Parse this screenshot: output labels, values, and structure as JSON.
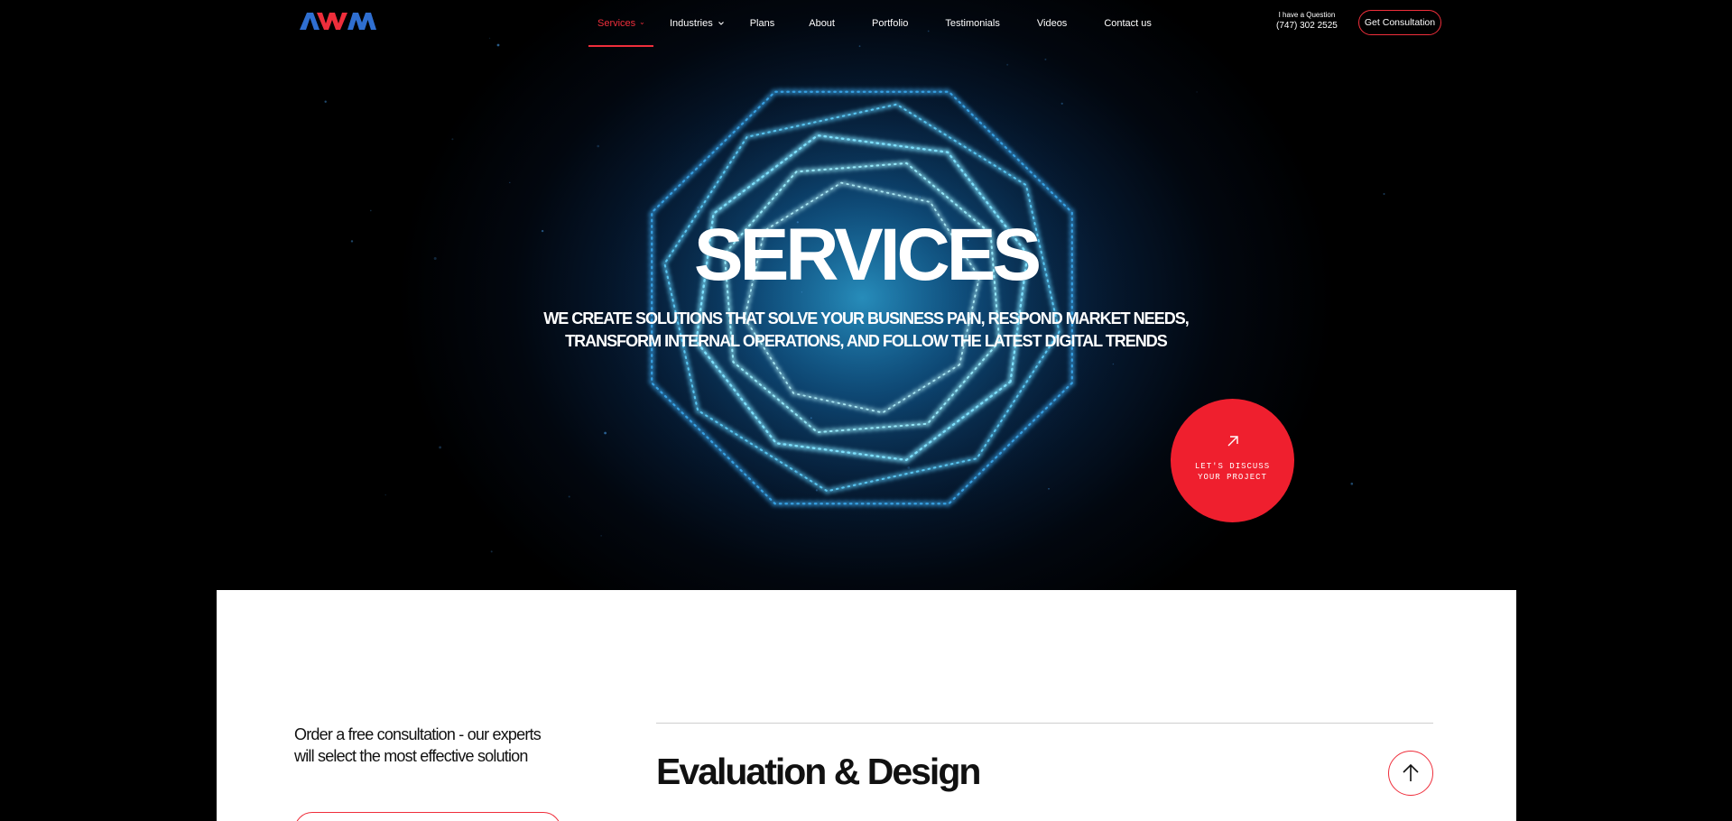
{
  "brand": {
    "logo_text": "AWM",
    "accent_color": "#ef2e3b",
    "logo_blue": "#2f6fd1"
  },
  "nav": {
    "items": [
      {
        "label": "Services",
        "active": true,
        "has_dropdown": true
      },
      {
        "label": "Industries",
        "active": false,
        "has_dropdown": true
      },
      {
        "label": "Plans",
        "active": false,
        "has_dropdown": false
      },
      {
        "label": "About",
        "active": false,
        "has_dropdown": false
      },
      {
        "label": "Portfolio",
        "active": false,
        "has_dropdown": false
      },
      {
        "label": "Testimonials",
        "active": false,
        "has_dropdown": false
      },
      {
        "label": "Videos",
        "active": false,
        "has_dropdown": false
      },
      {
        "label": "Contact us",
        "active": false,
        "has_dropdown": false
      }
    ]
  },
  "header": {
    "question_label": "I have a Question",
    "phone": "(747) 302 2525",
    "cta_label": "Get Consultation"
  },
  "hero": {
    "title": "SERVICES",
    "subtitle_line1": "WE CREATE SOLUTIONS THAT SOLVE YOUR BUSINESS PAIN, RESPOND MARKET NEEDS,",
    "subtitle_line2": "TRANSFORM INTERNAL OPERATIONS, AND FOLLOW THE LATEST DIGITAL TRENDS",
    "discuss_line1": "LET'S DISCUSS",
    "discuss_line2": "YOUR PROJECT",
    "icons": {
      "discuss": "arrow-up-right-icon"
    }
  },
  "section": {
    "consult_line1": "Order a free consultation - our experts",
    "consult_line2": "will select the most effective solution",
    "title": "Evaluation & Design",
    "icons": {
      "toggle": "arrow-up-icon"
    }
  }
}
